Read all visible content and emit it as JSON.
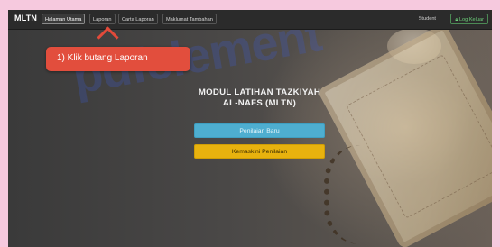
{
  "navbar": {
    "brand": "MLTN",
    "items": [
      {
        "label": "Halaman Utama",
        "active": true
      },
      {
        "label": "Laporan",
        "active": false
      },
      {
        "label": "Carta Laporan",
        "active": false
      },
      {
        "label": "Maklumat Tambahan",
        "active": false
      }
    ],
    "user": "Student",
    "logout_label": "Log Keluar",
    "logout_icon": "lock-icon"
  },
  "watermark": "pdfelement",
  "callout": {
    "text": "1)  Klik butang Laporan",
    "color": "#e24e3d"
  },
  "main": {
    "title_line1": "MODUL LATIHAN TAZKIYAH",
    "title_line2": "AL-NAFS (MLTN)",
    "buttons": {
      "new_assessment": "Penilaian Baru",
      "update_assessment": "Kemaskini Penilaian"
    }
  },
  "colors": {
    "page_background": "#f6c9de",
    "navbar": "#2b2b2b",
    "primary_button": "#4eaed0",
    "warning_button": "#e8b20e"
  }
}
